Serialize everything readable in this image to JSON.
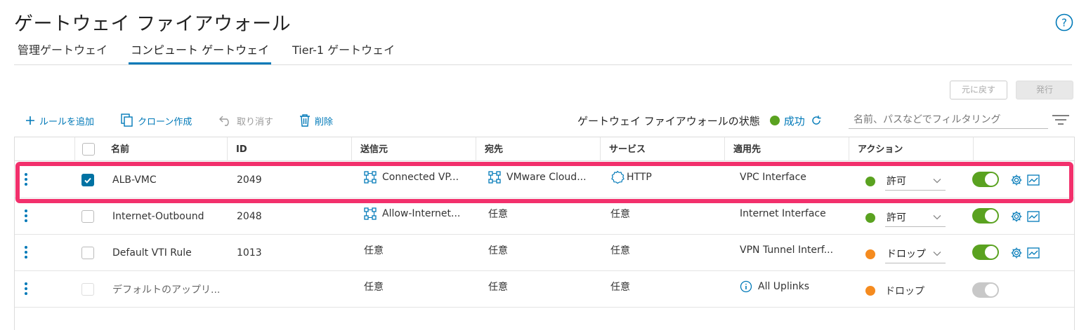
{
  "page": {
    "title": "ゲートウェイ ファイアウォール"
  },
  "tabs": [
    {
      "label": "管理ゲートウェイ",
      "active": false
    },
    {
      "label": "コンピュート ゲートウェイ",
      "active": true
    },
    {
      "label": "Tier-1 ゲートウェイ",
      "active": false
    }
  ],
  "buttons": {
    "revert": "元に戻す",
    "publish": "発行"
  },
  "toolbar": {
    "add_rule": "ルールを追加",
    "clone": "クローン作成",
    "undo": "取り消す",
    "delete": "削除"
  },
  "status": {
    "label": "ゲートウェイ ファイアウォールの状態",
    "value": "成功",
    "color": "#5aa220"
  },
  "filter": {
    "placeholder": "名前、パスなどでフィルタリング"
  },
  "columns": [
    "名前",
    "ID",
    "送信元",
    "宛先",
    "サービス",
    "適用先",
    "アクション"
  ],
  "colors": {
    "accent": "#0079b8",
    "allow": "#5aa220",
    "drop": "#f58b1f",
    "highlight": "#f2306c"
  },
  "rows": [
    {
      "checked": true,
      "disabled": false,
      "name": "ALB-VMC",
      "id": "2049",
      "source": "Connected VP...",
      "source_icon": "group-icon",
      "destination": "VMware Cloud...",
      "destination_icon": "group-icon",
      "service": "HTTP",
      "service_icon": "service-icon",
      "applied_to": "VPC Interface",
      "applied_icon": "",
      "action": "許可",
      "action_type": "allow",
      "enabled": true,
      "show_icons": true
    },
    {
      "checked": false,
      "disabled": false,
      "name": "Internet-Outbound",
      "id": "2048",
      "source": "Allow-Internet...",
      "source_icon": "group-icon",
      "destination": "任意",
      "destination_icon": "",
      "service": "任意",
      "service_icon": "",
      "applied_to": "Internet Interface",
      "applied_icon": "",
      "action": "許可",
      "action_type": "allow",
      "enabled": true,
      "show_icons": true
    },
    {
      "checked": false,
      "disabled": false,
      "name": "Default VTI Rule",
      "id": "1013",
      "source": "任意",
      "source_icon": "",
      "destination": "任意",
      "destination_icon": "",
      "service": "任意",
      "service_icon": "",
      "applied_to": "VPN Tunnel Interf...",
      "applied_icon": "",
      "action": "ドロップ",
      "action_type": "drop",
      "enabled": true,
      "show_icons": true
    },
    {
      "checked": false,
      "disabled": true,
      "name": "デフォルトのアップリ...",
      "id": "",
      "source": "任意",
      "source_icon": "",
      "destination": "任意",
      "destination_icon": "",
      "service": "任意",
      "service_icon": "",
      "applied_to": "All Uplinks",
      "applied_icon": "info-icon",
      "action": "ドロップ",
      "action_type": "drop",
      "enabled": false,
      "show_icons": false
    }
  ]
}
